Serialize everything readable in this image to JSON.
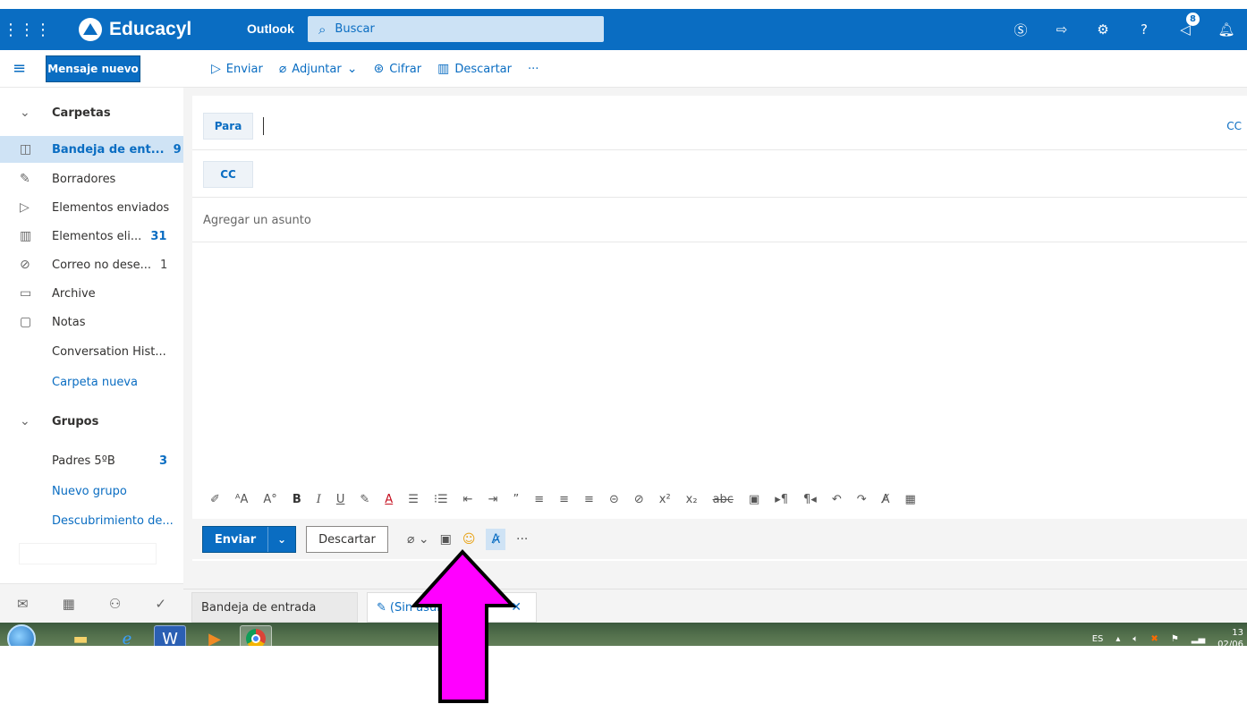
{
  "topbar": {
    "brand": "Educacyl",
    "app": "Outlook",
    "search_placeholder": "Buscar",
    "notification_count": "8"
  },
  "commands": {
    "new_mail": "Mensaje nuevo",
    "send": "Enviar",
    "attach": "Adjuntar",
    "encrypt": "Cifrar",
    "discard": "Descartar",
    "more": "···"
  },
  "sidebar": {
    "folders_header": "Carpetas",
    "items": [
      {
        "label": "Bandeja de ent...",
        "count": "9",
        "icon": "inbox-icon"
      },
      {
        "label": "Borradores",
        "count": "",
        "icon": "pencil-icon"
      },
      {
        "label": "Elementos enviados",
        "count": "",
        "icon": "send-icon"
      },
      {
        "label": "Elementos eli...",
        "count": "31",
        "icon": "trash-icon"
      },
      {
        "label": "Correo no dese...",
        "count": "1",
        "icon": "junk-icon"
      },
      {
        "label": "Archive",
        "count": "",
        "icon": "archive-icon"
      },
      {
        "label": "Notas",
        "count": "",
        "icon": "notes-icon"
      },
      {
        "label": "Conversation Hist...",
        "count": ""
      }
    ],
    "new_folder": "Carpeta nueva",
    "groups_header": "Grupos",
    "groups": [
      {
        "label": "Padres 5ºB",
        "count": "3"
      }
    ],
    "new_group": "Nuevo grupo",
    "discover": "Descubrimiento de..."
  },
  "compose": {
    "to_label": "Para",
    "cc_label": "CC",
    "cc_right": "CC",
    "subject_placeholder": "Agregar un asunto",
    "send_button": "Enviar",
    "discard_button": "Descartar"
  },
  "tabs": {
    "inbox": "Bandeja de entrada",
    "draft": "(Sin asunto)"
  },
  "taskbar": {
    "lang": "ES",
    "time": "13",
    "date": "02/06"
  },
  "colors": {
    "brand_blue": "#0a6dc2",
    "annotation_arrow": "#ff00ff"
  }
}
